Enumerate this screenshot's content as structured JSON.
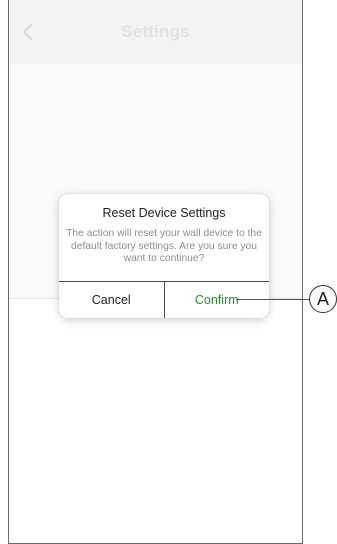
{
  "header": {
    "title": "Settings",
    "back_icon": "chevron-left-icon"
  },
  "dialog": {
    "title": "Reset Device Settings",
    "message": "The action will reset your wall device to the default factory settings. Are you sure you want to continue?",
    "cancel_label": "Cancel",
    "confirm_label": "Confirm"
  },
  "annotation": {
    "label": "A"
  },
  "colors": {
    "confirm": "#2f8a2f",
    "title_faded": "#e2e2e2",
    "header_bg": "#f3f3f3",
    "message": "#8e8e8e"
  }
}
